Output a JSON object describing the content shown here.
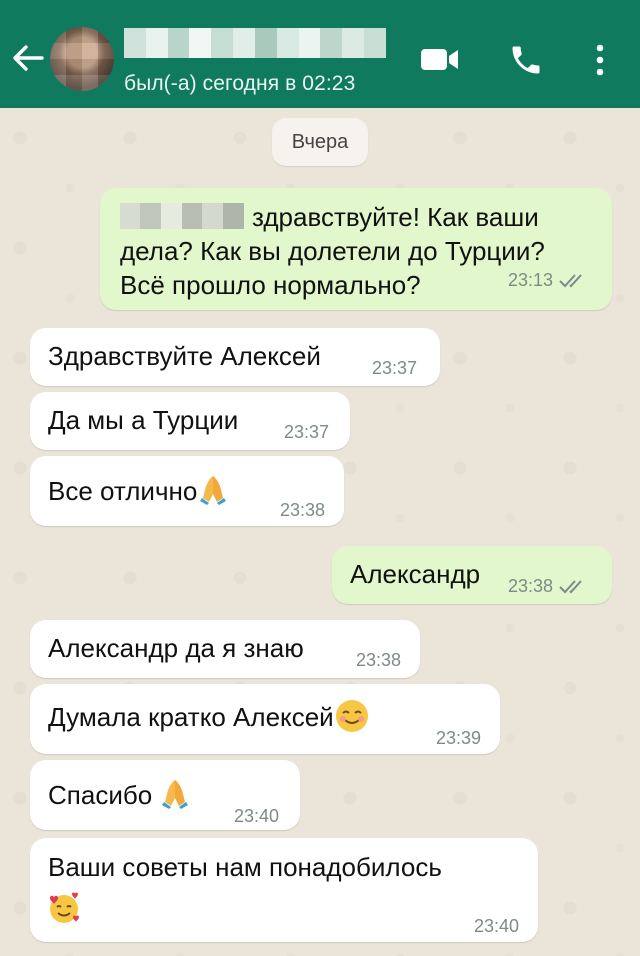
{
  "header": {
    "status": "был(-а) сегодня в 02:23"
  },
  "chat": {
    "date_chip": "Вчера",
    "messages": [
      {
        "dir": "out",
        "lines": [
          "здравствуйте! Как ваши",
          "дела? Как вы долетели до Турции?",
          "Всё прошло нормально?"
        ],
        "time": "23:13"
      },
      {
        "dir": "in",
        "text": "Здравствуйте Алексей",
        "time": "23:37"
      },
      {
        "dir": "in",
        "text": "Да мы а Турции",
        "time": "23:37"
      },
      {
        "dir": "in",
        "text": "Все отлично",
        "time": "23:38"
      },
      {
        "dir": "out",
        "text": "Александр",
        "time": "23:38"
      },
      {
        "dir": "in",
        "text": "Александр да я знаю",
        "time": "23:38"
      },
      {
        "dir": "in",
        "text": "Думала кратко Алексей",
        "time": "23:39"
      },
      {
        "dir": "in",
        "text": "Спасибо",
        "time": "23:40"
      },
      {
        "dir": "in",
        "text": "Ваши советы нам понадобилось",
        "time": "23:40"
      }
    ]
  },
  "icons": {
    "back": "arrow-left-icon",
    "video": "video-camera-icon",
    "phone": "phone-icon",
    "menu": "more-vertical-icon",
    "pray": "folded-hands-emoji",
    "smile": "smiling-face-emoji",
    "hearts": "smiling-face-with-hearts-emoji",
    "read": "double-check-icon"
  },
  "colors": {
    "header": "#0f7a5e",
    "outgoing": "#e2f7cb",
    "incoming": "#ffffff",
    "read_ticks": "#7e8a8a"
  }
}
